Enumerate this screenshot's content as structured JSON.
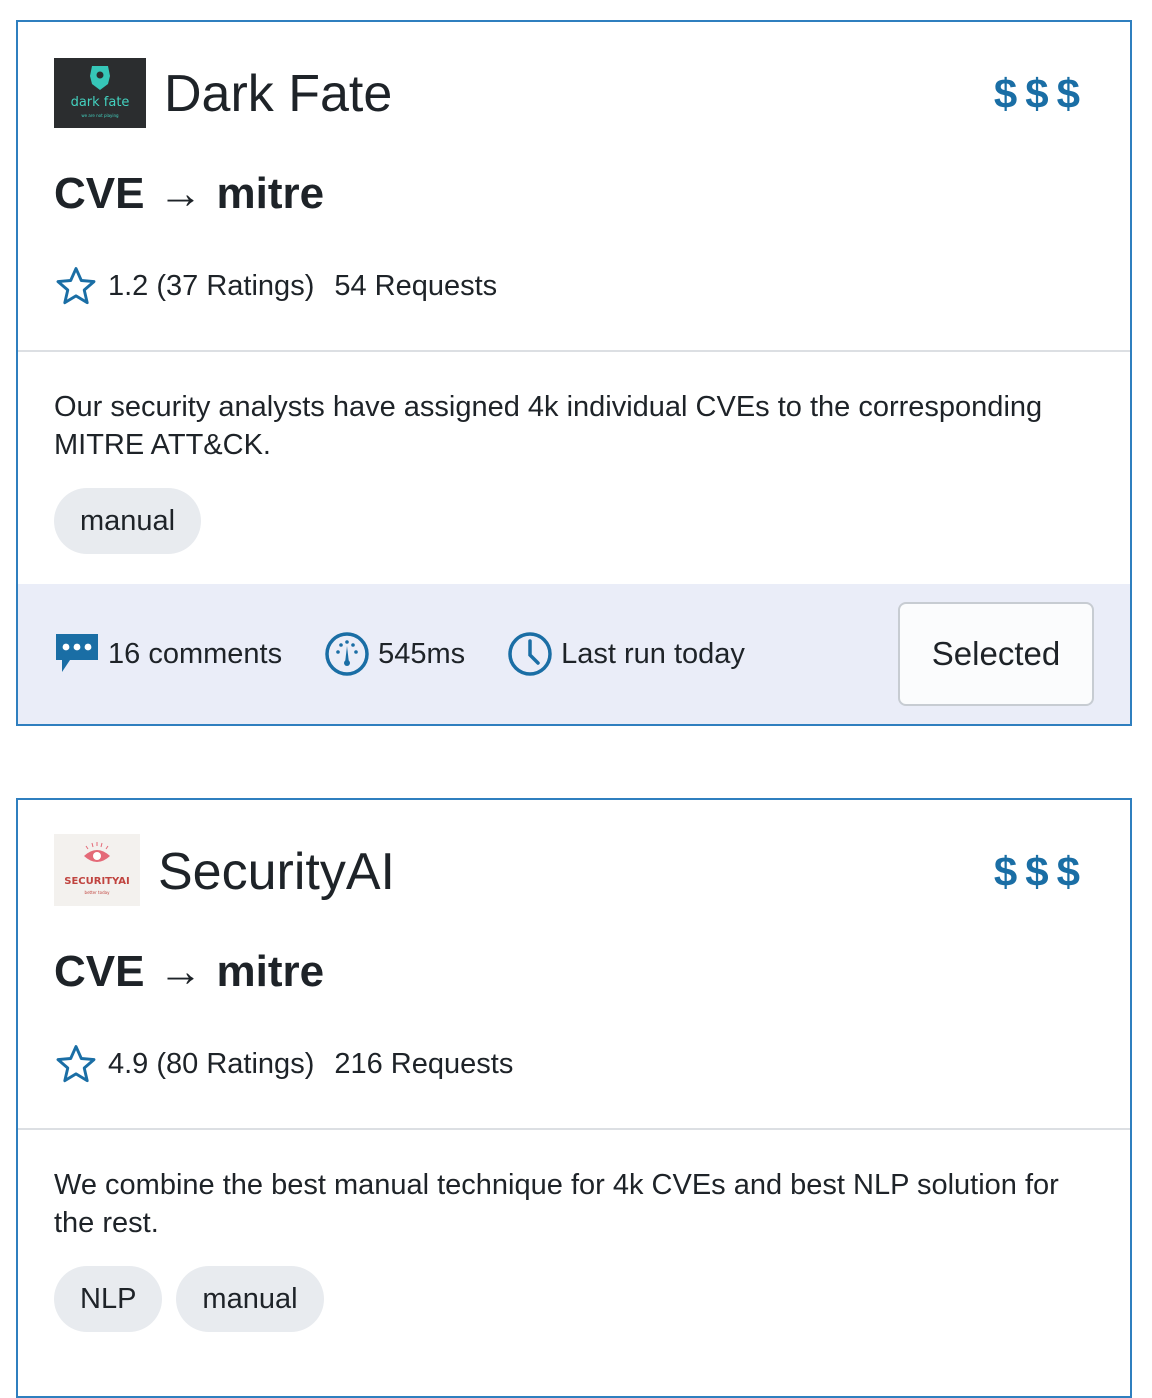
{
  "cards": [
    {
      "provider": "Dark Fate",
      "logo_text": "dark fate",
      "logo_subtext": "we are not playing",
      "price": "$$$",
      "mapping_from": "CVE",
      "mapping_arrow": "→",
      "mapping_to": "mitre",
      "rating": "1.2",
      "ratings_count": "(37 Ratings)",
      "requests": "54 Requests",
      "description": "Our security analysts have assigned 4k individual CVEs to the corresponding MITRE ATT&CK.",
      "tags": [
        "manual"
      ],
      "comments": "16 comments",
      "latency": "545ms",
      "last_run": "Last run today",
      "button_label": "Selected"
    },
    {
      "provider": "SecurityAI",
      "logo_text": "SECURITYAI",
      "logo_subtext": "better today",
      "price": "$$$",
      "mapping_from": "CVE",
      "mapping_arrow": "→",
      "mapping_to": "mitre",
      "rating": "4.9",
      "ratings_count": "(80 Ratings)",
      "requests": "216 Requests",
      "description": "We combine the best manual technique for 4k CVEs and best NLP solution for the rest.",
      "tags": [
        "NLP",
        "manual"
      ]
    }
  ],
  "colors": {
    "accent": "#1a6ea5",
    "border": "#2f7fbf",
    "footer_bg": "#eaedf8",
    "tag_bg": "#e8ebef"
  }
}
